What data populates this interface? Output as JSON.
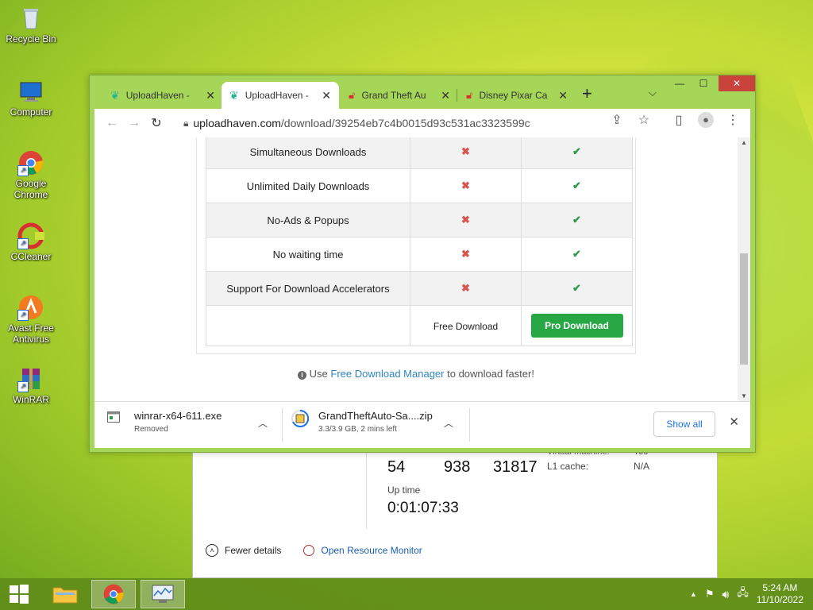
{
  "desktop": {
    "icons": [
      {
        "label": "Recycle Bin",
        "icon": "recycle-bin-icon"
      },
      {
        "label": "Computer",
        "icon": "computer-icon"
      },
      {
        "label": "Google Chrome",
        "icon": "chrome-icon"
      },
      {
        "label": "CCleaner",
        "icon": "ccleaner-icon"
      },
      {
        "label": "Avast Free Antivirus",
        "icon": "avast-icon"
      },
      {
        "label": "WinRAR",
        "icon": "winrar-icon"
      }
    ]
  },
  "task_manager": {
    "values": [
      "54",
      "938",
      "31817"
    ],
    "uptime_label": "Up time",
    "uptime_value": "0:01:07:33",
    "right_labels": [
      "Virtual machine:",
      "L1 cache:"
    ],
    "right_values": [
      "Yes",
      "N/A"
    ],
    "fewer_details": "Fewer details",
    "open_resource_monitor": "Open Resource Monitor"
  },
  "browser": {
    "tabs": [
      {
        "title": "UploadHaven -",
        "active": false
      },
      {
        "title": "UploadHaven -",
        "active": true
      },
      {
        "title": "Grand Theft Au",
        "active": false
      },
      {
        "title": "Disney Pixar Ca",
        "active": false
      }
    ],
    "url_host": "uploadhaven.com",
    "url_path": "/download/39254eb7c4b0015d93c531ac3323599c",
    "features": [
      "Simultaneous Downloads",
      "Unlimited Daily Downloads",
      "No-Ads & Popups",
      "No waiting time",
      "Support For Download Accelerators"
    ],
    "free_download_label": "Free Download",
    "pro_download_label": "Pro Download",
    "fdm_prefix": "Use",
    "fdm_link": "Free Download Manager",
    "fdm_suffix": "to download faster!",
    "colors": {
      "yes": "#2e9a4a",
      "no": "#d9534f",
      "pro_button": "#28a745"
    }
  },
  "downloads": [
    {
      "filename": "winrar-x64-611.exe",
      "status": "Removed"
    },
    {
      "filename": "GrandTheftAuto-Sa....zip",
      "status": "3.3/3.9 GB, 2 mins left"
    }
  ],
  "downloads_show_all": "Show all",
  "taskbar": {
    "clock_time": "5:24 AM",
    "clock_date": "11/10/2022"
  }
}
